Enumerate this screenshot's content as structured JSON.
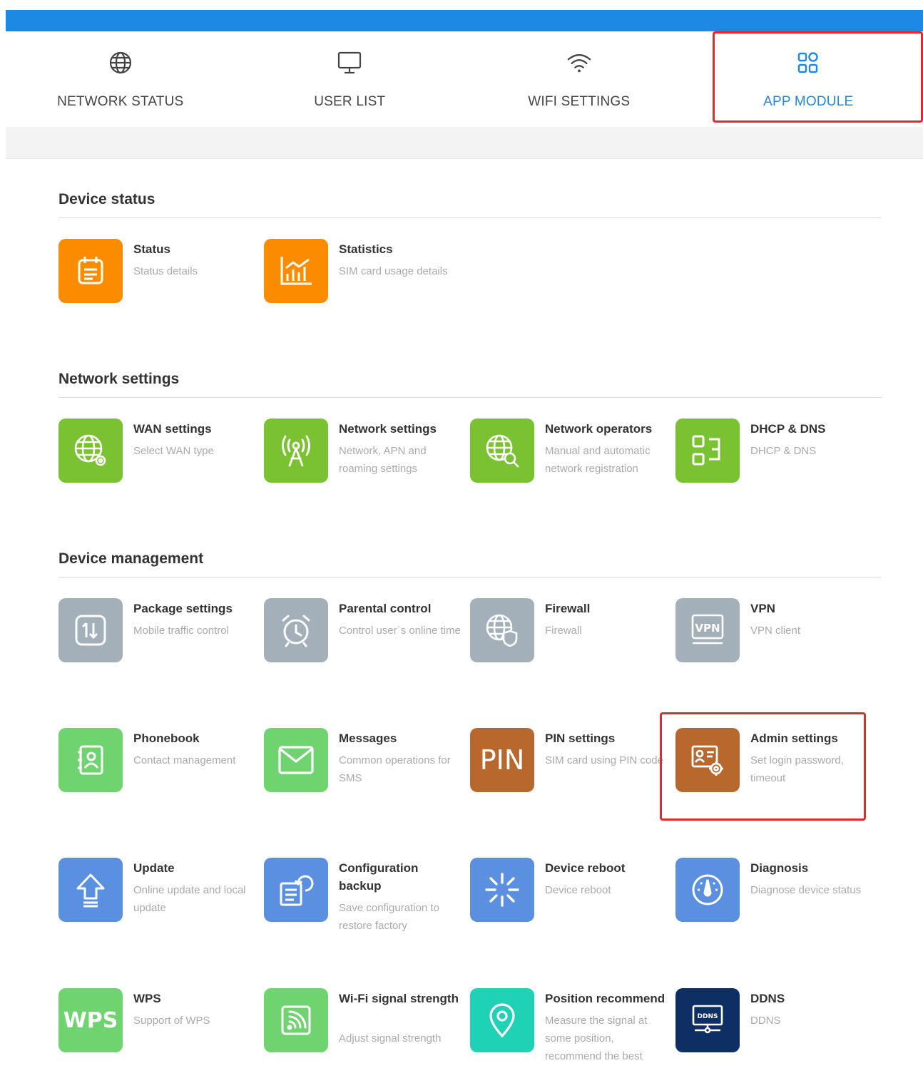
{
  "colors": {
    "topbar": "#1e88e5",
    "active": "#1e88e5",
    "highlight": "#e8262b",
    "orange": "#fb8c00",
    "green": "#7ac231",
    "gray": "#a3b0b9",
    "lightgreen": "#6fd36f",
    "brown": "#b8682c",
    "blue": "#5b8fe0",
    "teal": "#1fd1b5",
    "navy": "#0d2f63"
  },
  "nav": [
    {
      "label": "NETWORK STATUS",
      "icon": "globe-icon"
    },
    {
      "label": "USER LIST",
      "icon": "monitor-icon"
    },
    {
      "label": "WIFI SETTINGS",
      "icon": "wifi-icon"
    },
    {
      "label": "APP MODULE",
      "icon": "grid-icon",
      "active": true
    }
  ],
  "sections": [
    {
      "title": "Device status"
    },
    {
      "title": "Network settings"
    },
    {
      "title": "Device management"
    }
  ],
  "tiles": [
    {
      "title": "Status",
      "desc": "Status details",
      "icon": "clipboard-icon"
    },
    {
      "title": "Statistics",
      "desc": "SIM card usage details",
      "icon": "chart-icon"
    },
    {
      "title": "WAN settings",
      "desc": "Select WAN type",
      "icon": "globe-gear-icon"
    },
    {
      "title": "Network settings",
      "desc": "Network, APN and roaming settings",
      "icon": "antenna-icon"
    },
    {
      "title": "Network operators",
      "desc": "Manual and automatic network registration",
      "icon": "globe-search-icon"
    },
    {
      "title": "DHCP & DNS",
      "desc": "DHCP & DNS",
      "icon": "dhcp-icon"
    },
    {
      "title": "Package settings",
      "desc": "Mobile traffic control",
      "icon": "traffic-icon"
    },
    {
      "title": "Parental control",
      "desc": "Control user`s online time",
      "icon": "alarm-clock-icon"
    },
    {
      "title": "Firewall",
      "desc": "Firewall",
      "icon": "globe-shield-icon"
    },
    {
      "title": "VPN",
      "desc": "VPN client",
      "icon": "vpn-icon"
    },
    {
      "title": "Phonebook",
      "desc": "Contact management",
      "icon": "contact-book-icon"
    },
    {
      "title": "Messages",
      "desc": "Common operations for SMS",
      "icon": "envelope-icon"
    },
    {
      "title": "PIN settings",
      "desc": "SIM card using PIN code",
      "icon": "pin-icon",
      "icon_text": "PIN"
    },
    {
      "title": "Admin settings",
      "desc": "Set login password, timeout",
      "icon": "admin-card-icon",
      "highlighted": true
    },
    {
      "title": "Update",
      "desc": "Online update and local update",
      "icon": "upload-arrow-icon"
    },
    {
      "title": "Configuration backup",
      "desc": "Save configuration to restore factory",
      "icon": "backup-icon"
    },
    {
      "title": "Device reboot",
      "desc": "Device reboot",
      "icon": "reboot-spinner-icon"
    },
    {
      "title": "Diagnosis",
      "desc": "Diagnose device status",
      "icon": "gauge-icon"
    },
    {
      "title": "WPS",
      "desc": "Support of WPS",
      "icon": "wps-icon",
      "icon_text": "WPS"
    },
    {
      "title": "Wi-Fi signal strength",
      "desc": "Adjust signal strength",
      "icon": "wifi-signal-icon"
    },
    {
      "title": "Position recommend",
      "desc": "Measure the signal at some position, recommend the best",
      "icon": "location-pin-icon"
    },
    {
      "title": "DDNS",
      "desc": "DDNS",
      "icon": "ddns-icon",
      "icon_text": "DDNS"
    }
  ]
}
